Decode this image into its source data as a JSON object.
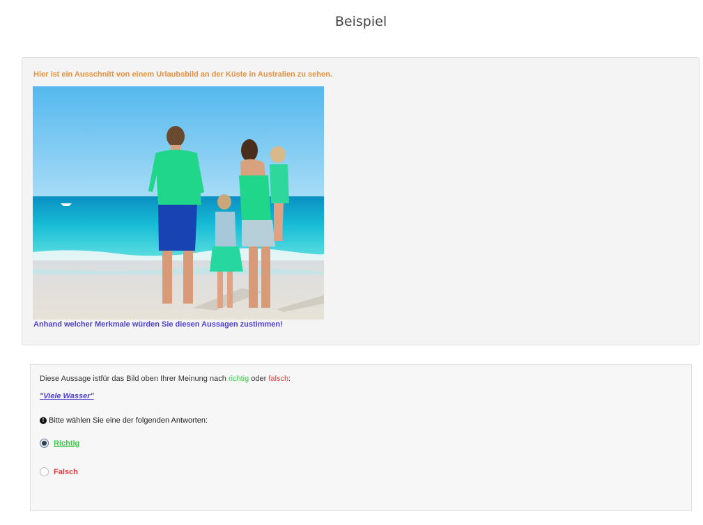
{
  "page": {
    "title": "Beispiel"
  },
  "info": {
    "intro": "Hier ist ein Ausschnitt von einem Urlaubsbild an der Küste in Australien zu sehen.",
    "prompt": "Anhand welcher Merkmale würden Sie diesen Aussagen zustimmen!"
  },
  "question": {
    "text_before": "Diese Aussage istfür das Bild oben Ihrer Meinung nach ",
    "word_correct": "richtig",
    "text_or": " oder ",
    "word_wrong": "falsch",
    "text_after": ":",
    "statement": "\"Viele Wasser\"",
    "instruction": "Bitte wählen Sie eine der folgenden Antworten:",
    "options": [
      {
        "label": "Richtig",
        "checked": true,
        "color": "#3cc84a"
      },
      {
        "label": "Falsch",
        "checked": false,
        "color": "#e23b3b"
      }
    ]
  },
  "colors": {
    "intro": "#e8913c",
    "prompt": "#4a3fd1",
    "sea": "#1ec3d6",
    "sky": "#6ec3ef",
    "shirt": "#22d37f"
  }
}
